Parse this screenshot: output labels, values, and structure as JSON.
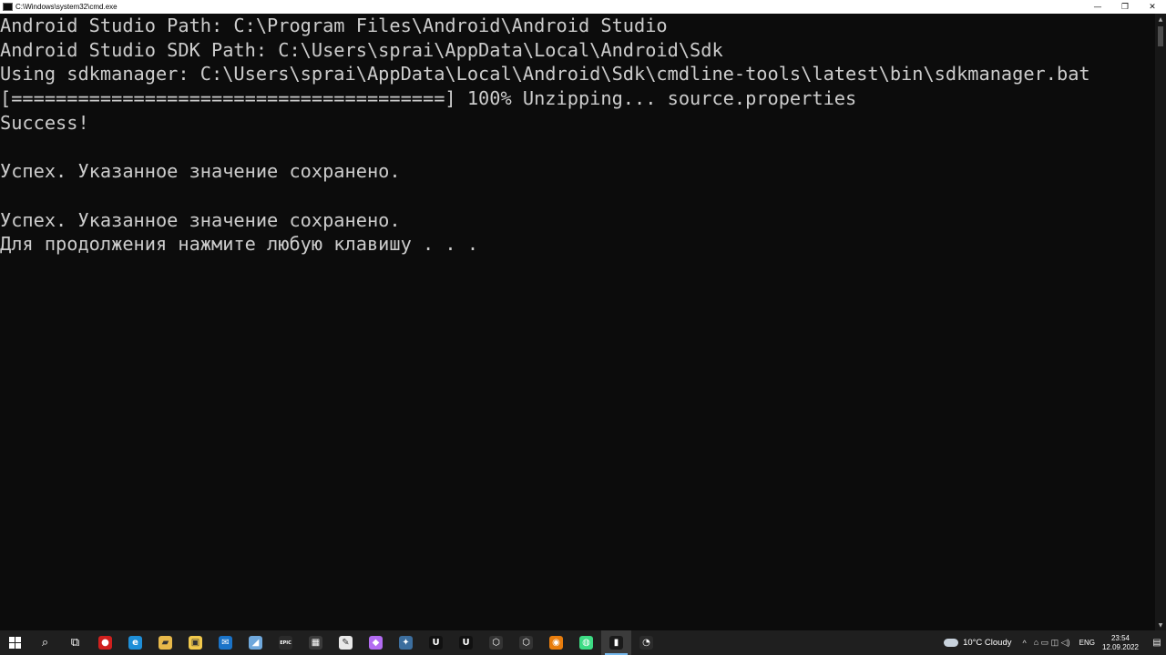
{
  "window": {
    "title": "C:\\Windows\\system32\\cmd.exe",
    "minimize_glyph": "—",
    "maximize_glyph": "❐",
    "close_glyph": "✕"
  },
  "console": {
    "lines": [
      "Android Studio Path: C:\\Program Files\\Android\\Android Studio",
      "Android Studio SDK Path: C:\\Users\\sprai\\AppData\\Local\\Android\\Sdk",
      "Using sdkmanager: C:\\Users\\sprai\\AppData\\Local\\Android\\Sdk\\cmdline-tools\\latest\\bin\\sdkmanager.bat",
      "[=======================================] 100% Unzipping... source.properties",
      "Success!",
      "",
      "Успех. Указанное значение сохранено.",
      "",
      "Успех. Указанное значение сохранено.",
      "Для продолжения нажмите любую клавишу . . ."
    ]
  },
  "scrollbar": {
    "up_glyph": "▲",
    "down_glyph": "▼"
  },
  "taskbar": {
    "apps": [
      {
        "name": "start-button",
        "icon": "windows-logo-icon",
        "color": "#ffffff",
        "glyph": ""
      },
      {
        "name": "search-button",
        "icon": "search-icon",
        "color": "#ffffff",
        "glyph": "⌕"
      },
      {
        "name": "task-view-button",
        "icon": "task-view-icon",
        "color": "#ffffff",
        "glyph": "⧉"
      },
      {
        "name": "taskbar-app-1",
        "icon": "red-circle-app-icon",
        "color": "#d0201e",
        "glyph": "●"
      },
      {
        "name": "taskbar-edge",
        "icon": "edge-icon",
        "color": "#1f8fd8",
        "glyph": "e"
      },
      {
        "name": "taskbar-file-explorer",
        "icon": "folder-icon",
        "color": "#e8b94a",
        "glyph": "▰"
      },
      {
        "name": "taskbar-store",
        "icon": "store-icon",
        "color": "#f2c94c",
        "glyph": "▣"
      },
      {
        "name": "taskbar-mail",
        "icon": "mail-icon",
        "color": "#1a73c8",
        "glyph": "✉"
      },
      {
        "name": "taskbar-app-blue",
        "icon": "blue-app-icon",
        "color": "#6fa8dc",
        "glyph": "◢"
      },
      {
        "name": "taskbar-epic-games",
        "icon": "epic-games-icon",
        "color": "#2b2b2b",
        "glyph": "EPIC"
      },
      {
        "name": "taskbar-app-clapper",
        "icon": "clapper-icon",
        "color": "#3a3a3a",
        "glyph": "▦"
      },
      {
        "name": "taskbar-app-edit",
        "icon": "edit-icon",
        "color": "#e8e8e8",
        "glyph": "✎"
      },
      {
        "name": "taskbar-app-drop",
        "icon": "drop-icon",
        "color": "#b36cf2",
        "glyph": "◆"
      },
      {
        "name": "taskbar-davinci",
        "icon": "davinci-icon",
        "color": "#3c6e9e",
        "glyph": "✦"
      },
      {
        "name": "taskbar-unreal-1",
        "icon": "unreal-icon",
        "color": "#111111",
        "glyph": "U"
      },
      {
        "name": "taskbar-unreal-2",
        "icon": "unreal-icon",
        "color": "#111111",
        "glyph": "U"
      },
      {
        "name": "taskbar-unity-1",
        "icon": "unity-icon",
        "color": "#333333",
        "glyph": "⬡"
      },
      {
        "name": "taskbar-unity-2",
        "icon": "unity-icon",
        "color": "#333333",
        "glyph": "⬡"
      },
      {
        "name": "taskbar-blender",
        "icon": "blender-icon",
        "color": "#e87d0d",
        "glyph": "◉"
      },
      {
        "name": "taskbar-android-studio",
        "icon": "android-studio-icon",
        "color": "#3ddc84",
        "glyph": "◍"
      },
      {
        "name": "taskbar-cmd",
        "icon": "command-prompt-icon",
        "color": "#1a1a1a",
        "glyph": "▮",
        "active": true
      },
      {
        "name": "taskbar-app-red",
        "icon": "red-app-icon",
        "color": "#2b2b2b",
        "glyph": "◔"
      }
    ],
    "tray": {
      "weather": "10°C  Cloudy",
      "chevron_glyph": "^",
      "system_glyphs": "⌂ ▭ ◫ ◁)",
      "language": "ENG",
      "time": "23:54",
      "date": "12.09.2022",
      "notification_glyph": "▤"
    }
  }
}
